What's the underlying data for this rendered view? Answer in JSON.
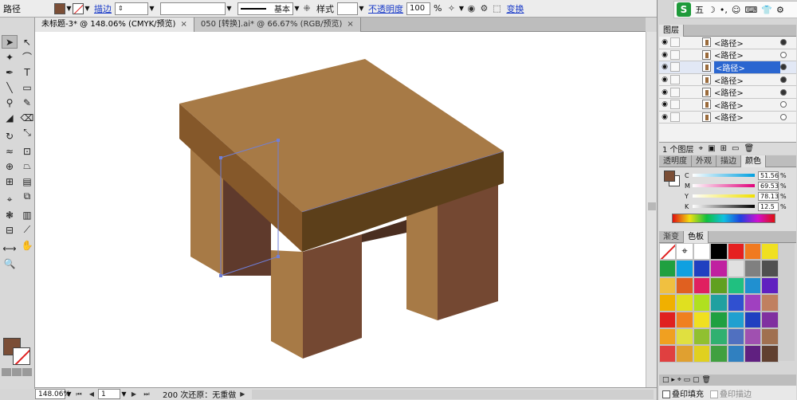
{
  "control_bar": {
    "object_type": "路径",
    "fill_color": "#7b4e36",
    "stroke_label": "描边",
    "stroke_weight": "",
    "brush_field": "",
    "stroke_profile": "基本",
    "style_label": "样式",
    "opacity_label": "不透明度",
    "opacity_value": "100",
    "opacity_unit": "%",
    "transform_link": "变换"
  },
  "document_tabs": [
    {
      "title": "未标题-3* @ 148.06% (CMYK/预览)",
      "close": "×",
      "active": true
    },
    {
      "title": "050 [转换].ai* @ 66.67% (RGB/预览)",
      "close": "×",
      "active": false
    }
  ],
  "status_bar": {
    "zoom": "148.06%",
    "page": "1",
    "undo_text": "200 次还原：无重做"
  },
  "ime_bar": {
    "logo": "S",
    "mode": "五",
    "moon": "☽",
    "punct": "•,",
    "emoji": "☺",
    "keyboard": "⌨",
    "skin": "👕",
    "tools": "⚙"
  },
  "layers_panel": {
    "tab": "图层",
    "rows": [
      {
        "name": "<路径>",
        "dot": "filled",
        "selected": false
      },
      {
        "name": "<路径>",
        "dot": "empty",
        "selected": false
      },
      {
        "name": "<路径>",
        "dot": "filled",
        "selected": true
      },
      {
        "name": "<路径>",
        "dot": "filled",
        "selected": false
      },
      {
        "name": "<路径>",
        "dot": "filled",
        "selected": false
      },
      {
        "name": "<路径>",
        "dot": "empty",
        "selected": false
      },
      {
        "name": "<路径>",
        "dot": "empty",
        "selected": false
      }
    ],
    "footer_count": "1 个图层"
  },
  "color_panel": {
    "tabs": [
      "透明度",
      "外观",
      "描边",
      "颜色"
    ],
    "active_tab": "颜色",
    "fill_color": "#7b4e36",
    "channels": [
      {
        "label": "C",
        "value": "51.56",
        "gradient": "linear-gradient(to right,#ffffff,#00a0e0)"
      },
      {
        "label": "M",
        "value": "69.53",
        "gradient": "linear-gradient(to right,#ffffff,#e0007a)"
      },
      {
        "label": "Y",
        "value": "78.13",
        "gradient": "linear-gradient(to right,#ffffff,#f0e000)"
      },
      {
        "label": "K",
        "value": "12.5",
        "gradient": "linear-gradient(to right,#ffffff,#000000)"
      }
    ],
    "unit": "%"
  },
  "swatches_panel": {
    "tabs": [
      "渐变",
      "色板"
    ],
    "active_tab": "色板",
    "colors": [
      "#ffffff",
      "#ffffff",
      "#ffffff",
      "#000000",
      "#e52020",
      "#f07a20",
      "#f0e020",
      "#20a040",
      "#10a0e0",
      "#2040c0",
      "#c020a0",
      "#e0e0e0",
      "#808080",
      "#505050",
      "#f0c040",
      "#e06020",
      "#e02060",
      "#60a020",
      "#20c080",
      "#2090d0",
      "#6020c0",
      "#f0b000",
      "#e0e020",
      "#b0e020",
      "#20a0a0",
      "#3050d0",
      "#a040c0",
      "#c08060",
      "#e02020",
      "#f08020",
      "#f0e020",
      "#20a040",
      "#20a0d0",
      "#2040c0",
      "#8030a0",
      "#f0a020",
      "#e0e040",
      "#90c030",
      "#30b070",
      "#5070c0",
      "#a050b0",
      "#a07050",
      "#e04040",
      "#e0a030",
      "#e0d020",
      "#40a040",
      "#3080c0",
      "#602080",
      "#604030"
    ],
    "footer_left": "□ ▸ ⌖ ▭ ▢ 🗑",
    "overprint_fill": "叠印填充",
    "overprint_stroke": "叠印描边"
  },
  "tools": [
    "selection-tool",
    "direct-selection-tool",
    "magic-wand-tool",
    "lasso-tool",
    "pen-tool",
    "type-tool",
    "line-tool",
    "rectangle-tool",
    "paintbrush-tool",
    "pencil-tool",
    "blob-brush-tool",
    "eraser-tool",
    "rotate-tool",
    "scale-tool",
    "warp-tool",
    "free-transform-tool",
    "shape-builder-tool",
    "perspective-tool",
    "mesh-tool",
    "gradient-tool",
    "eyedropper-tool",
    "blend-tool",
    "symbol-sprayer-tool",
    "column-graph-tool",
    "artboard-tool",
    "slice-tool",
    "width-tool",
    "hand-tool",
    "zoom-tool"
  ],
  "canvas": {
    "top_color": "#a77a46",
    "apron_front": "#5c3f1a",
    "apron_left": "#85582a",
    "leg_light": "#a77a46",
    "leg_dark": "#744832",
    "shadow_leg": "#5f3a2c"
  }
}
